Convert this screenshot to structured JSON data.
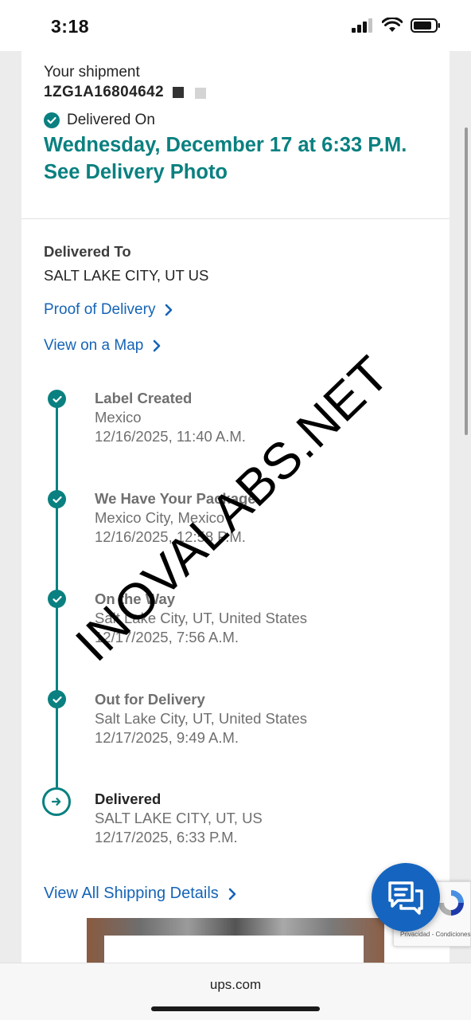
{
  "status_bar": {
    "time": "3:18"
  },
  "shipment": {
    "label": "Your shipment",
    "tracking_number": "1ZG1A16804642",
    "status_label": "Delivered On",
    "delivery_datetime": "Wednesday, December 17 at 6:33 P.M.",
    "photo_link": "See Delivery Photo"
  },
  "delivered_to": {
    "heading": "Delivered To",
    "location": "SALT LAKE CITY, UT US"
  },
  "links": {
    "proof_of_delivery": "Proof of Delivery",
    "view_on_map": "View on a Map",
    "view_all_shipping": "View All Shipping Details"
  },
  "timeline": [
    {
      "title": "Label Created",
      "location": "Mexico",
      "datetime": "12/16/2025, 11:40 A.M."
    },
    {
      "title": "We Have Your Package",
      "location": "Mexico City, Mexico",
      "datetime": "12/16/2025, 12:58 P.M."
    },
    {
      "title": "On the Way",
      "location": "Salt Lake City, UT, United States",
      "datetime": "12/17/2025, 7:56 A.M."
    },
    {
      "title": "Out for Delivery",
      "location": "Salt Lake City, UT, United States",
      "datetime": "12/17/2025, 9:49 A.M."
    },
    {
      "title": "Delivered",
      "location": "SALT LAKE CITY, UT, US",
      "datetime": "12/17/2025, 6:33 P.M."
    }
  ],
  "watermark": "INOVALABS.NET",
  "recaptcha": {
    "text": "Privacidad - Condiciones"
  },
  "browser": {
    "url": "ups.com"
  },
  "colors": {
    "accent_teal": "#0a8080",
    "link_blue": "#1564b7",
    "chat_blue": "#1565c0"
  }
}
